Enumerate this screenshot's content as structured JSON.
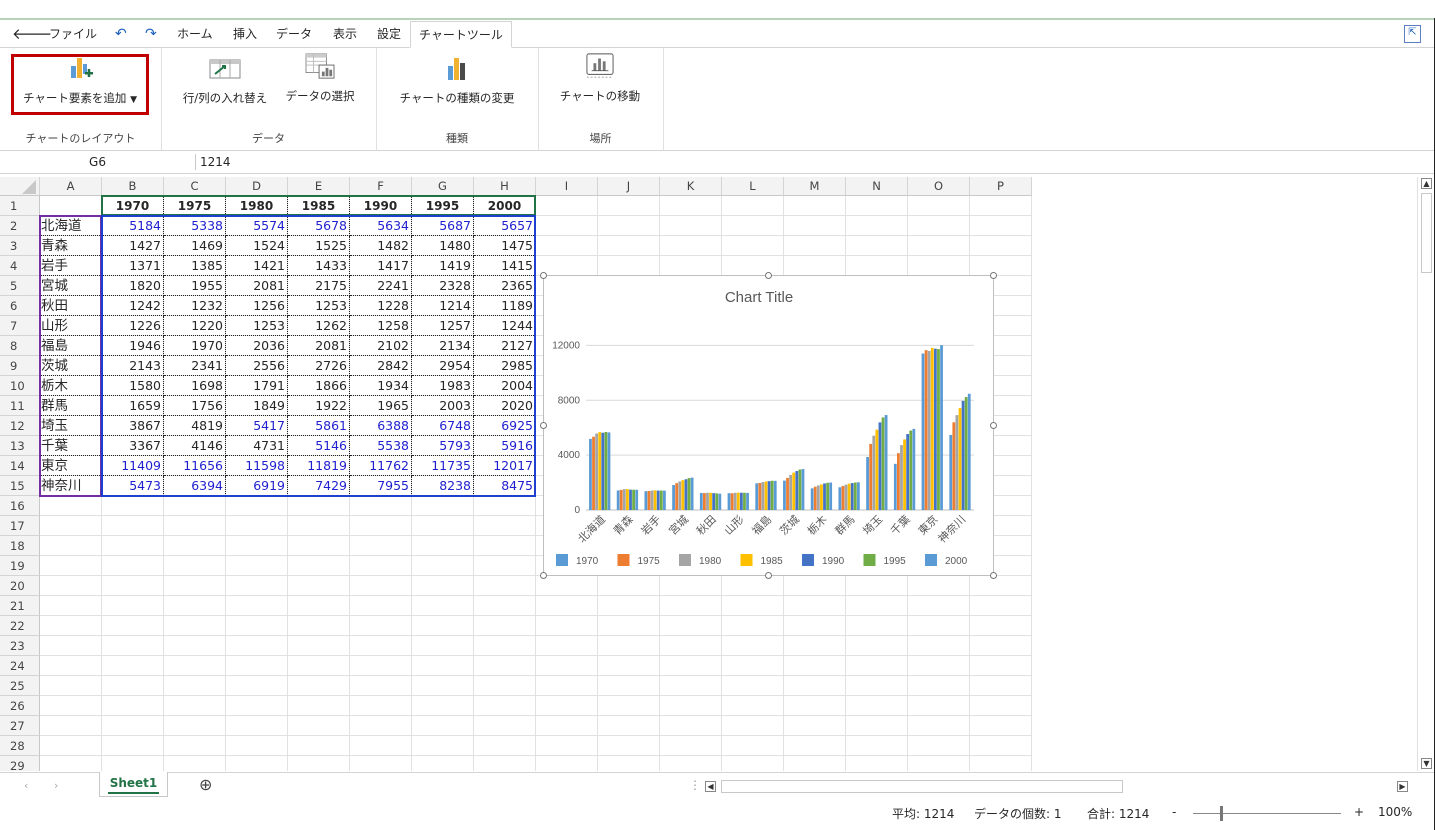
{
  "menu": {
    "items": [
      "ファイル",
      "ホーム",
      "挿入",
      "データ",
      "表示",
      "設定"
    ],
    "active_tab": "チャートツール"
  },
  "ribbon": {
    "groups": [
      {
        "label": "チャートのレイアウト",
        "buttons": [
          "チャート要素を追加"
        ]
      },
      {
        "label": "データ",
        "buttons": [
          "行/列の入れ替え",
          "データの選択"
        ]
      },
      {
        "label": "種類",
        "buttons": [
          "チャートの種類の変更"
        ]
      },
      {
        "label": "場所",
        "buttons": [
          "チャートの移動"
        ]
      }
    ]
  },
  "formula_bar": {
    "name_box": "G6",
    "value": "1214"
  },
  "columns": [
    "A",
    "B",
    "C",
    "D",
    "E",
    "F",
    "G",
    "H",
    "I",
    "J",
    "K",
    "L",
    "M",
    "N",
    "O",
    "P"
  ],
  "rows": [
    "1",
    "2",
    "3",
    "4",
    "5",
    "6",
    "7",
    "8",
    "9",
    "10",
    "11",
    "12",
    "13",
    "14",
    "15",
    "16",
    "17",
    "18",
    "19",
    "20",
    "21",
    "22",
    "23",
    "24",
    "25",
    "26",
    "27",
    "28",
    "29"
  ],
  "sheet": {
    "header": [
      "1970",
      "1975",
      "1980",
      "1985",
      "1990",
      "1995",
      "2000"
    ],
    "data": [
      {
        "name": "北海道",
        "values": [
          "5184",
          "5338",
          "5574",
          "5678",
          "5634",
          "5687",
          "5657"
        ],
        "blue": true
      },
      {
        "name": "青森",
        "values": [
          "1427",
          "1469",
          "1524",
          "1525",
          "1482",
          "1480",
          "1475"
        ],
        "blue": false
      },
      {
        "name": "岩手",
        "values": [
          "1371",
          "1385",
          "1421",
          "1433",
          "1417",
          "1419",
          "1415"
        ],
        "blue": false
      },
      {
        "name": "宮城",
        "values": [
          "1820",
          "1955",
          "2081",
          "2175",
          "2241",
          "2328",
          "2365"
        ],
        "blue": false
      },
      {
        "name": "秋田",
        "values": [
          "1242",
          "1232",
          "1256",
          "1253",
          "1228",
          "1214",
          "1189"
        ],
        "blue": false
      },
      {
        "name": "山形",
        "values": [
          "1226",
          "1220",
          "1253",
          "1262",
          "1258",
          "1257",
          "1244"
        ],
        "blue": false
      },
      {
        "name": "福島",
        "values": [
          "1946",
          "1970",
          "2036",
          "2081",
          "2102",
          "2134",
          "2127"
        ],
        "blue": false
      },
      {
        "name": "茨城",
        "values": [
          "2143",
          "2341",
          "2556",
          "2726",
          "2842",
          "2954",
          "2985"
        ],
        "blue": false
      },
      {
        "name": "栃木",
        "values": [
          "1580",
          "1698",
          "1791",
          "1866",
          "1934",
          "1983",
          "2004"
        ],
        "blue": false
      },
      {
        "name": "群馬",
        "values": [
          "1659",
          "1756",
          "1849",
          "1922",
          "1965",
          "2003",
          "2020"
        ],
        "blue": false
      },
      {
        "name": "埼玉",
        "values": [
          "3867",
          "4819",
          "5417",
          "5861",
          "6388",
          "6748",
          "6925"
        ],
        "blue": "partial"
      },
      {
        "name": "千葉",
        "values": [
          "3367",
          "4146",
          "4731",
          "5146",
          "5538",
          "5793",
          "5916"
        ],
        "blue": "partial"
      },
      {
        "name": "東京",
        "values": [
          "11409",
          "11656",
          "11598",
          "11819",
          "11762",
          "11735",
          "12017"
        ],
        "blue": true
      },
      {
        "name": "神奈川",
        "values": [
          "5473",
          "6394",
          "6919",
          "7429",
          "7955",
          "8238",
          "8475"
        ],
        "blue": true
      }
    ]
  },
  "chart_data": {
    "type": "bar",
    "title": "Chart Title",
    "categories": [
      "北海道",
      "青森",
      "岩手",
      "宮城",
      "秋田",
      "山形",
      "福島",
      "茨城",
      "栃木",
      "群馬",
      "埼玉",
      "千葉",
      "東京",
      "神奈川"
    ],
    "series": [
      {
        "name": "1970",
        "color": "#5b9bd5",
        "values": [
          5184,
          1427,
          1371,
          1820,
          1242,
          1226,
          1946,
          2143,
          1580,
          1659,
          3867,
          3367,
          11409,
          5473
        ]
      },
      {
        "name": "1975",
        "color": "#ed7d31",
        "values": [
          5338,
          1469,
          1385,
          1955,
          1232,
          1220,
          1970,
          2341,
          1698,
          1756,
          4819,
          4146,
          11656,
          6394
        ]
      },
      {
        "name": "1980",
        "color": "#a5a5a5",
        "values": [
          5574,
          1524,
          1421,
          2081,
          1256,
          1253,
          2036,
          2556,
          1791,
          1849,
          5417,
          4731,
          11598,
          6919
        ]
      },
      {
        "name": "1985",
        "color": "#ffc000",
        "values": [
          5678,
          1525,
          1433,
          2175,
          1253,
          1262,
          2081,
          2726,
          1866,
          1922,
          5861,
          5146,
          11819,
          7429
        ]
      },
      {
        "name": "1990",
        "color": "#4472c4",
        "values": [
          5634,
          1482,
          1417,
          2241,
          1228,
          1258,
          2102,
          2842,
          1934,
          1965,
          6388,
          5538,
          11762,
          7955
        ]
      },
      {
        "name": "1995",
        "color": "#70ad47",
        "values": [
          5687,
          1480,
          1419,
          2328,
          1214,
          1257,
          2134,
          2954,
          1983,
          2003,
          6748,
          5793,
          11735,
          8238
        ]
      },
      {
        "name": "2000",
        "color": "#5b9bd5",
        "values": [
          5657,
          1475,
          1415,
          2365,
          1189,
          1244,
          2127,
          2985,
          2004,
          2020,
          6925,
          5916,
          12017,
          8475
        ]
      }
    ],
    "yticks": [
      "0",
      "4000",
      "8000",
      "12000"
    ],
    "ylim": [
      0,
      14000
    ],
    "legend": "bottom",
    "grid": true
  },
  "sheet_tab": "Sheet1",
  "status": {
    "average": "平均: 1214",
    "count": "データの個数: 1",
    "sum": "合計: 1214",
    "zoom": "100%",
    "minus": "-",
    "plus": "+"
  }
}
